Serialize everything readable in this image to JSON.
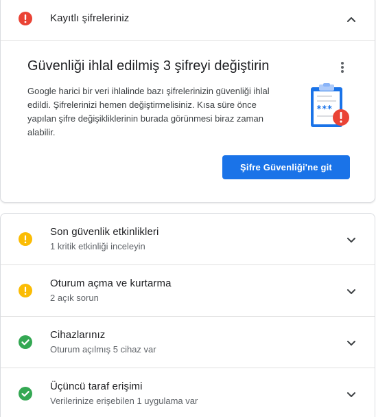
{
  "header": {
    "title": "Kayıtlı şifreleriniz",
    "status": "error",
    "status_icon": "error-icon",
    "chevron_icon": "chevron-up-icon"
  },
  "alert_card": {
    "title": "Güvenliği ihlal edilmiş 3 şifreyi değiştirin",
    "description": "Google harici bir veri ihlalinde bazı şifrelerinizin güvenliği ihlal edildi. Şifrelerinizi hemen değiştirmelisiniz. Kısa süre önce yapılan şifre değişikliklerinin burada görünmesi biraz zaman alabilir.",
    "action_label": "Şifre Güvenliği'ne git",
    "more_icon": "more-vert-icon",
    "illustration_icon": "password-clipboard-icon",
    "illustration_text": "***"
  },
  "items": [
    {
      "title": "Son güvenlik etkinlikleri",
      "subtitle": "1 kritik etkinliği inceleyin",
      "status": "warning",
      "status_icon": "warning-icon"
    },
    {
      "title": "Oturum açma ve kurtarma",
      "subtitle": "2 açık sorun",
      "status": "warning",
      "status_icon": "warning-icon"
    },
    {
      "title": "Cihazlarınız",
      "subtitle": "Oturum açılmış 5 cihaz var",
      "status": "ok",
      "status_icon": "check-icon"
    },
    {
      "title": "Üçüncü taraf erişimi",
      "subtitle": "Verilerinize erişebilen 1 uygulama var",
      "status": "ok",
      "status_icon": "check-icon"
    }
  ],
  "colors": {
    "error": "#ea4335",
    "warning": "#fbbc04",
    "ok": "#34a853",
    "primary": "#1a73e8"
  }
}
